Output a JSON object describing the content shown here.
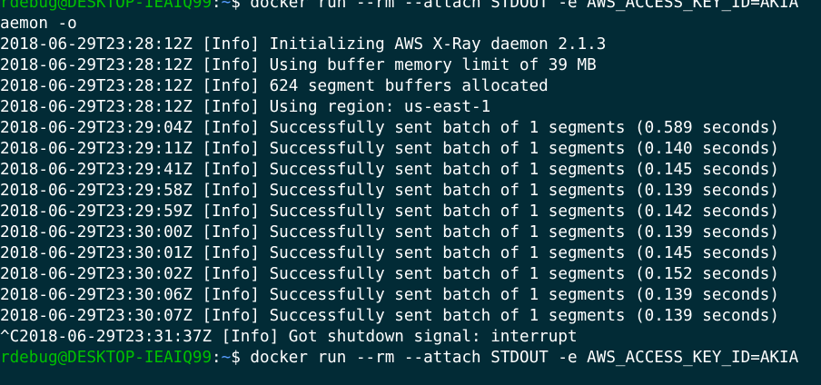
{
  "terminal": {
    "prompt": {
      "user_host": "rdebug@DESKTOP-IEAIQ99",
      "separator": ":",
      "path": "~",
      "symbol": "$ "
    },
    "command_first": "docker run --rm --attach STDOUT -e AWS_ACCESS_KEY_ID=AKIA",
    "command_wrap": "aemon -o",
    "log_lines": [
      "2018-06-29T23:28:12Z [Info] Initializing AWS X-Ray daemon 2.1.3",
      "2018-06-29T23:28:12Z [Info] Using buffer memory limit of 39 MB",
      "2018-06-29T23:28:12Z [Info] 624 segment buffers allocated",
      "2018-06-29T23:28:12Z [Info] Using region: us-east-1",
      "2018-06-29T23:29:04Z [Info] Successfully sent batch of 1 segments (0.589 seconds)",
      "2018-06-29T23:29:11Z [Info] Successfully sent batch of 1 segments (0.140 seconds)",
      "2018-06-29T23:29:41Z [Info] Successfully sent batch of 1 segments (0.145 seconds)",
      "2018-06-29T23:29:58Z [Info] Successfully sent batch of 1 segments (0.139 seconds)",
      "2018-06-29T23:29:59Z [Info] Successfully sent batch of 1 segments (0.142 seconds)",
      "2018-06-29T23:30:00Z [Info] Successfully sent batch of 1 segments (0.139 seconds)",
      "2018-06-29T23:30:01Z [Info] Successfully sent batch of 1 segments (0.145 seconds)",
      "2018-06-29T23:30:02Z [Info] Successfully sent batch of 1 segments (0.152 seconds)",
      "2018-06-29T23:30:06Z [Info] Successfully sent batch of 1 segments (0.139 seconds)",
      "2018-06-29T23:30:07Z [Info] Successfully sent batch of 1 segments (0.139 seconds)"
    ],
    "shutdown_line": "^C2018-06-29T23:31:37Z [Info] Got shutdown signal: interrupt",
    "command_last": "docker run --rm --attach STDOUT -e AWS_ACCESS_KEY_ID=AKIA",
    "colors": {
      "background": "#022b36",
      "text": "#ffffff",
      "user_host": "#00c000",
      "path": "#569cff"
    }
  }
}
